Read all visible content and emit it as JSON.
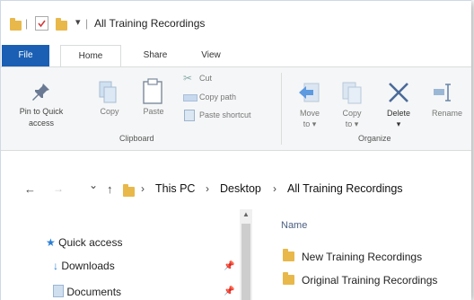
{
  "window": {
    "title": "All Training Recordings",
    "title_sep": "|",
    "qat_dropdown": "▾"
  },
  "tabs": [
    {
      "label": "File"
    },
    {
      "label": "Home"
    },
    {
      "label": "Share"
    },
    {
      "label": "View"
    }
  ],
  "ribbon": {
    "clipboard": {
      "group_label": "Clipboard",
      "pin_label_1": "Pin to Quick",
      "pin_label_2": "access",
      "copy_label": "Copy",
      "paste_label": "Paste",
      "cut_label": "Cut",
      "copy_path_label": "Copy path",
      "paste_shortcut_label": "Paste shortcut"
    },
    "organize": {
      "group_label": "Organize",
      "move_label_1": "Move",
      "move_label_2": "to",
      "copy_label_1": "Copy",
      "copy_label_2": "to",
      "delete_label": "Delete",
      "rename_label": "Rename"
    }
  },
  "address": {
    "back": "←",
    "forward": "→",
    "recent": "⌄",
    "up": "↑",
    "sep": "›",
    "crumbs": [
      "This PC",
      "Desktop",
      "All Training Recordings"
    ]
  },
  "nav_pane": {
    "items": [
      {
        "label": "Quick access",
        "icon": "star-icon"
      },
      {
        "label": "Downloads",
        "icon": "download-arrow-icon"
      },
      {
        "label": "Documents",
        "icon": "documents-icon"
      }
    ],
    "pin": "📌"
  },
  "content": {
    "column_header": "Name",
    "files": [
      {
        "name": "New Training Recordings",
        "icon": "folder-icon"
      },
      {
        "name": "Original Training Recordings",
        "icon": "folder-icon"
      }
    ]
  },
  "colors": {
    "accent": "#1a5fb4",
    "folder": "#e8b84a",
    "star": "#2a7fd4"
  }
}
